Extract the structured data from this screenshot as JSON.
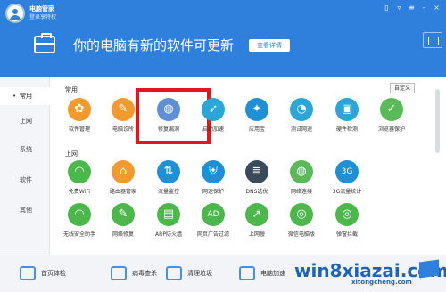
{
  "app": {
    "title": "电脑管家",
    "subtitle": "登录享特权"
  },
  "header": {
    "headline": "你的电脑有新的软件可更新",
    "detail_button": "查看详情"
  },
  "sidebar": {
    "items": [
      {
        "label": "常用",
        "active": true
      },
      {
        "label": "上网",
        "active": false
      },
      {
        "label": "系统",
        "active": false
      },
      {
        "label": "软件",
        "active": false
      },
      {
        "label": "其他",
        "active": false
      }
    ]
  },
  "main": {
    "custom_button": "自定义",
    "sections": [
      {
        "title": "常用",
        "tools": [
          {
            "label": "软件管理",
            "icon": "flower-icon",
            "color": "#f29a2e"
          },
          {
            "label": "电脑诊所",
            "icon": "wrench-icon",
            "color": "#f29a2e"
          },
          {
            "label": "修复漏洞",
            "icon": "globe-icon",
            "color": "#5b8fd6"
          },
          {
            "label": "启动加速",
            "icon": "rocket-icon",
            "color": "#2aa6d8"
          },
          {
            "label": "应用宝",
            "icon": "app-store-icon",
            "color": "#1f8fd6"
          },
          {
            "label": "测试网速",
            "icon": "speedometer-icon",
            "color": "#2aa6d8"
          },
          {
            "label": "硬件检测",
            "icon": "hardware-icon",
            "color": "#2aa6d8"
          },
          {
            "label": "浏览器保护",
            "icon": "browser-shield-icon",
            "color": "#5aba5a"
          }
        ]
      },
      {
        "title": "上网",
        "tools": [
          {
            "label": "免费WiFi",
            "icon": "wifi-icon",
            "color": "#4cb84c"
          },
          {
            "label": "路由器管家",
            "icon": "router-icon",
            "color": "#f29a2e"
          },
          {
            "label": "流量监控",
            "icon": "traffic-icon",
            "color": "#1f8fd6"
          },
          {
            "label": "网速保护",
            "icon": "shield-icon",
            "color": "#1f8fd6"
          },
          {
            "label": "DNS选优",
            "icon": "dns-icon",
            "color": "#3a4a5a"
          },
          {
            "label": "网络连接",
            "icon": "globe-icon",
            "color": "#5aba5a"
          },
          {
            "label": "3G流量统计",
            "icon": "3g-icon",
            "color": "#1f8fd6"
          }
        ]
      },
      {
        "title": "",
        "tools": [
          {
            "label": "无线安全助手",
            "icon": "wifi-shield-icon",
            "color": "#4cb84c"
          },
          {
            "label": "网络修复",
            "icon": "wrench-icon",
            "color": "#4cb84c"
          },
          {
            "label": "ARP防火墙",
            "icon": "firewall-icon",
            "color": "#4cb84c"
          },
          {
            "label": "网页广告过滤",
            "icon": "ad-filter-icon",
            "color": "#4cb84c"
          },
          {
            "label": "上网慢",
            "icon": "slow-network-icon",
            "color": "#4cb84c"
          },
          {
            "label": "微信电脑版",
            "icon": "wechat-icon",
            "color": "#4cb84c"
          },
          {
            "label": "弹窗拦截",
            "icon": "popup-block-icon",
            "color": "#4cb84c"
          }
        ]
      }
    ]
  },
  "footer": {
    "items": [
      {
        "label": "首页体检",
        "icon": "monitor-icon"
      },
      {
        "label": "病毒查杀",
        "icon": "antivirus-icon"
      },
      {
        "label": "清理垃圾",
        "icon": "broom-icon"
      },
      {
        "label": "电脑加速",
        "icon": "rocket-icon"
      }
    ]
  },
  "watermark": {
    "text": "win8xiazai.com",
    "sub": "xitongcheng.com"
  },
  "colors": {
    "header_bg": "#2f7fdc",
    "highlight_border": "#e3171b"
  }
}
